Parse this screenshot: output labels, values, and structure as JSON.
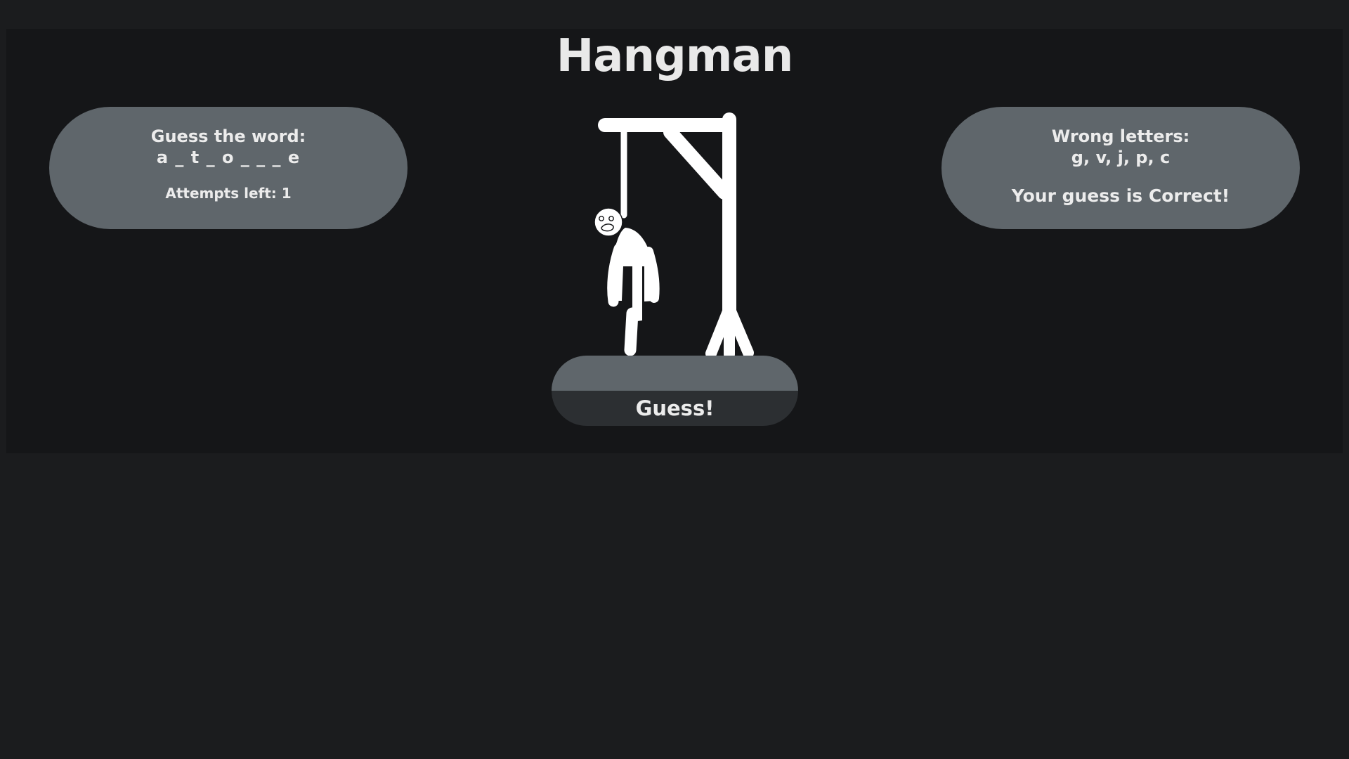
{
  "app": {
    "title": "Hangman"
  },
  "word_panel": {
    "label": "Guess the word:",
    "masked_word": "a _ t _ o _ _ _ e",
    "attempts_text": "Attempts left: 1"
  },
  "wrong_panel": {
    "label": "Wrong letters:",
    "letters": "g, v, j, p, c",
    "result_message": "Your guess is Correct!"
  },
  "guess": {
    "input_value": "",
    "button_label": "Guess!"
  },
  "colors": {
    "page_background": "#1b1c1e",
    "app_background": "#151618",
    "panel_background": "#5f666b",
    "button_background": "#2c2f32",
    "text": "#ececec",
    "drawing": "#ffffff"
  },
  "icons": {
    "hangman_figure": "hanged-stick-figure"
  }
}
